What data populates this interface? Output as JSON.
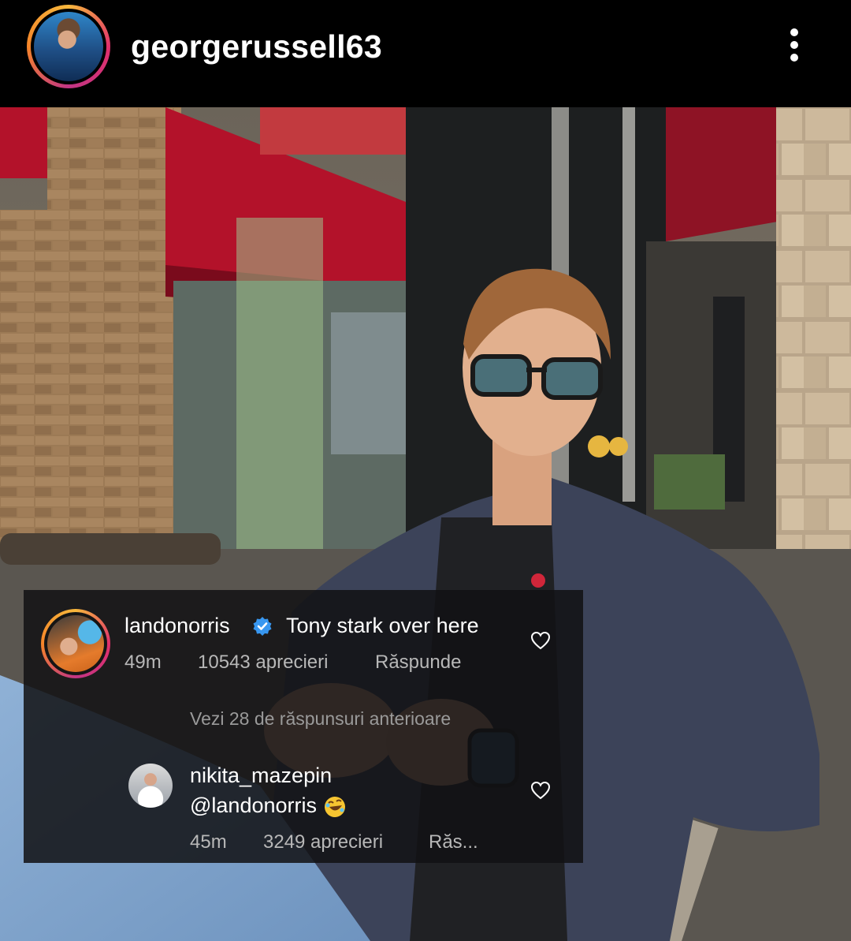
{
  "post": {
    "username": "georgerussell63"
  },
  "comments": [
    {
      "username": "landonorris",
      "verified": true,
      "text": "Tony stark over here",
      "time": "49m",
      "likes": "10543 aprecieri",
      "reply_label": "Răspunde"
    },
    {
      "username": "nikita_mazepin",
      "text": "@landonorris",
      "emoji": "rolling-on-floor-laughing",
      "time": "45m",
      "likes": "3249 aprecieri",
      "reply_label": "Răs..."
    }
  ],
  "view_replies_label": "Vezi 28 de răspunsuri anterioare",
  "colors": {
    "background": "#000000",
    "verified_badge": "#3897f0",
    "muted_text": "#b8b8b8",
    "awning_red": "#b3122a"
  }
}
